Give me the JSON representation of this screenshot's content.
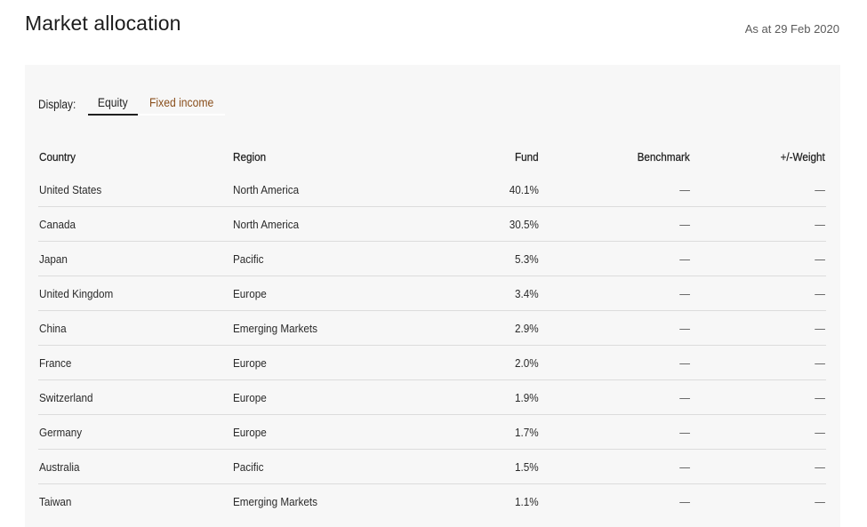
{
  "header": {
    "title": "Market allocation",
    "as_at": "As at 29 Feb 2020"
  },
  "display": {
    "label": "Display:",
    "tabs": [
      {
        "label": "Equity",
        "active": true
      },
      {
        "label": "Fixed income",
        "active": false
      }
    ]
  },
  "colors": {
    "accent_link": "#8a4f1c",
    "panel_bg": "#f7f7f7",
    "divider": "#dcdcdc"
  },
  "table": {
    "columns": [
      "Country",
      "Region",
      "Fund",
      "Benchmark",
      "+/-Weight"
    ],
    "rows": [
      {
        "country": "United States",
        "region": "North America",
        "fund": "40.1%",
        "benchmark": "—",
        "weight": "—"
      },
      {
        "country": "Canada",
        "region": "North America",
        "fund": "30.5%",
        "benchmark": "—",
        "weight": "—"
      },
      {
        "country": "Japan",
        "region": "Pacific",
        "fund": "5.3%",
        "benchmark": "—",
        "weight": "—"
      },
      {
        "country": "United Kingdom",
        "region": "Europe",
        "fund": "3.4%",
        "benchmark": "—",
        "weight": "—"
      },
      {
        "country": "China",
        "region": "Emerging Markets",
        "fund": "2.9%",
        "benchmark": "—",
        "weight": "—"
      },
      {
        "country": "France",
        "region": "Europe",
        "fund": "2.0%",
        "benchmark": "—",
        "weight": "—"
      },
      {
        "country": "Switzerland",
        "region": "Europe",
        "fund": "1.9%",
        "benchmark": "—",
        "weight": "—"
      },
      {
        "country": "Germany",
        "region": "Europe",
        "fund": "1.7%",
        "benchmark": "—",
        "weight": "—"
      },
      {
        "country": "Australia",
        "region": "Pacific",
        "fund": "1.5%",
        "benchmark": "—",
        "weight": "—"
      },
      {
        "country": "Taiwan",
        "region": "Emerging Markets",
        "fund": "1.1%",
        "benchmark": "—",
        "weight": "—"
      }
    ]
  }
}
